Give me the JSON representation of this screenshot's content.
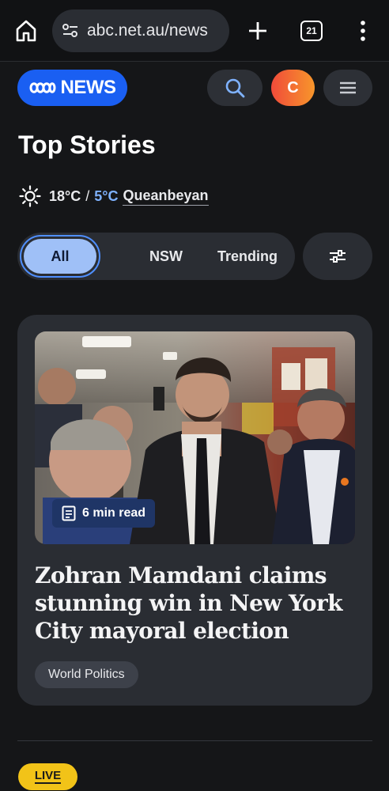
{
  "browser": {
    "url": "abc.net.au/news",
    "tab_count": "21"
  },
  "header": {
    "logo_text": "NEWS",
    "avatar_initial": "C"
  },
  "page": {
    "title": "Top Stories"
  },
  "weather": {
    "high": "18°C",
    "separator": "/",
    "low": "5°C",
    "location": "Queanbeyan"
  },
  "filters": {
    "tabs": [
      {
        "label": "All",
        "selected": true
      },
      {
        "label": "NSW",
        "selected": false
      },
      {
        "label": "Trending",
        "selected": false
      }
    ]
  },
  "story": {
    "read_time": "6 min read",
    "headline": "Zohran Mamdani claims stunning win in New York City mayoral election",
    "topic": "World Politics"
  },
  "next": {
    "badge": "LIVE"
  },
  "colors": {
    "brand": "#1a5ff2",
    "accent_low_temp": "#7fb2ff",
    "live": "#f2c318",
    "selected_tab": "#9fc0f7"
  },
  "icons": [
    "home-icon",
    "site-settings-icon",
    "new-tab-icon",
    "tab-switcher-icon",
    "overflow-menu-icon",
    "abc-logo-icon",
    "search-icon",
    "hamburger-icon",
    "sun-icon",
    "sliders-icon",
    "article-icon"
  ]
}
